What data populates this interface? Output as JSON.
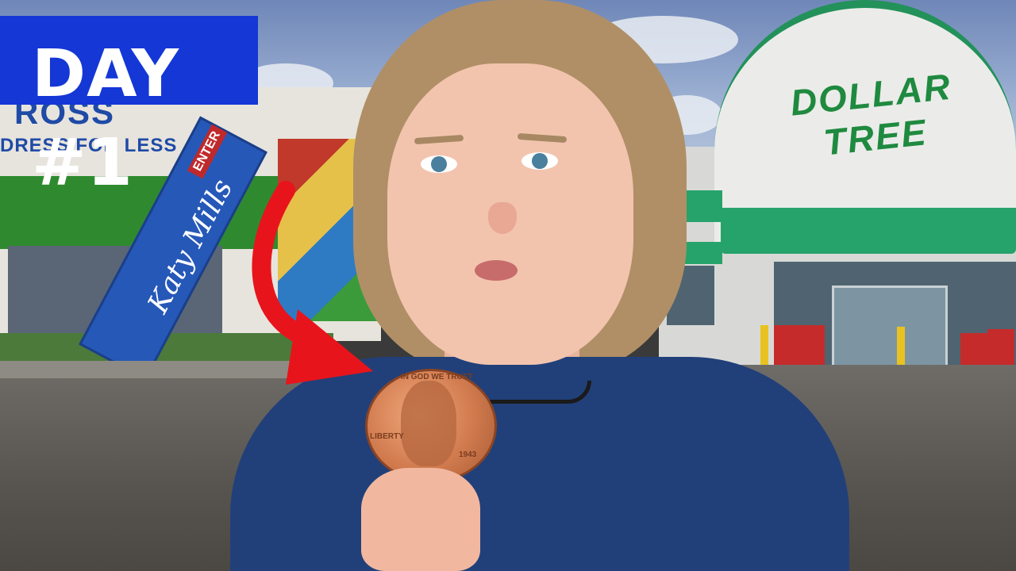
{
  "overlay": {
    "title": "DAY #1"
  },
  "signs": {
    "ross_logo": "ROSS",
    "ross_tagline": "DRESS FOR LESS",
    "katy_mills": "Katy Mills",
    "enter": "ENTER",
    "dollar_tree_line1": "DOLLAR",
    "dollar_tree_line2": "TREE"
  },
  "coin": {
    "motto": "IN GOD WE TRUST",
    "liberty": "LIBERTY",
    "year": "1943"
  },
  "colors": {
    "banner": "#1437d6",
    "arrow": "#e8141b",
    "dollar_tree_green": "#1f8a3f",
    "shirt": "#21407a"
  }
}
